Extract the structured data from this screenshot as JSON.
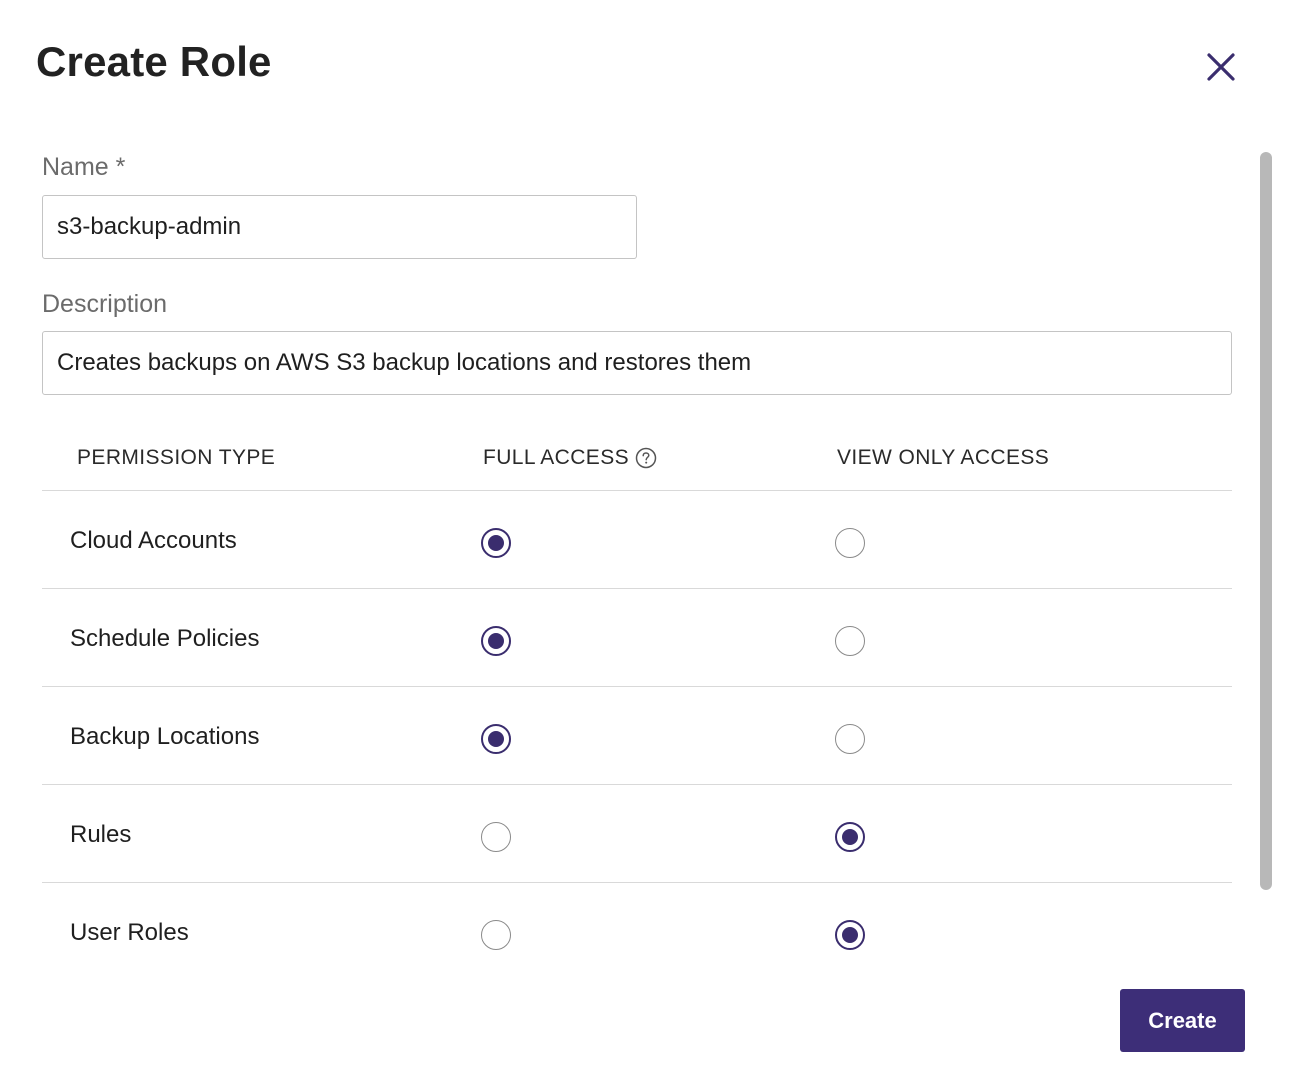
{
  "dialog": {
    "title": "Create Role",
    "close_icon": "close-icon"
  },
  "form": {
    "name_label": "Name *",
    "name_value": "s3-backup-admin",
    "description_label": "Description",
    "description_value": "Creates backups on AWS S3 backup locations and restores them"
  },
  "permissions": {
    "headers": {
      "type": "PERMISSION TYPE",
      "full": "FULL ACCESS",
      "view": "VIEW ONLY ACCESS"
    },
    "rows": [
      {
        "label": "Cloud Accounts",
        "selected": "full"
      },
      {
        "label": "Schedule Policies",
        "selected": "full"
      },
      {
        "label": "Backup Locations",
        "selected": "full"
      },
      {
        "label": "Rules",
        "selected": "view"
      },
      {
        "label": "User Roles",
        "selected": "view"
      }
    ]
  },
  "footer": {
    "create_label": "Create"
  },
  "colors": {
    "accent": "#3d2e78",
    "radio_checked": "#3a2d6e",
    "close_icon": "#3a2d6e"
  }
}
